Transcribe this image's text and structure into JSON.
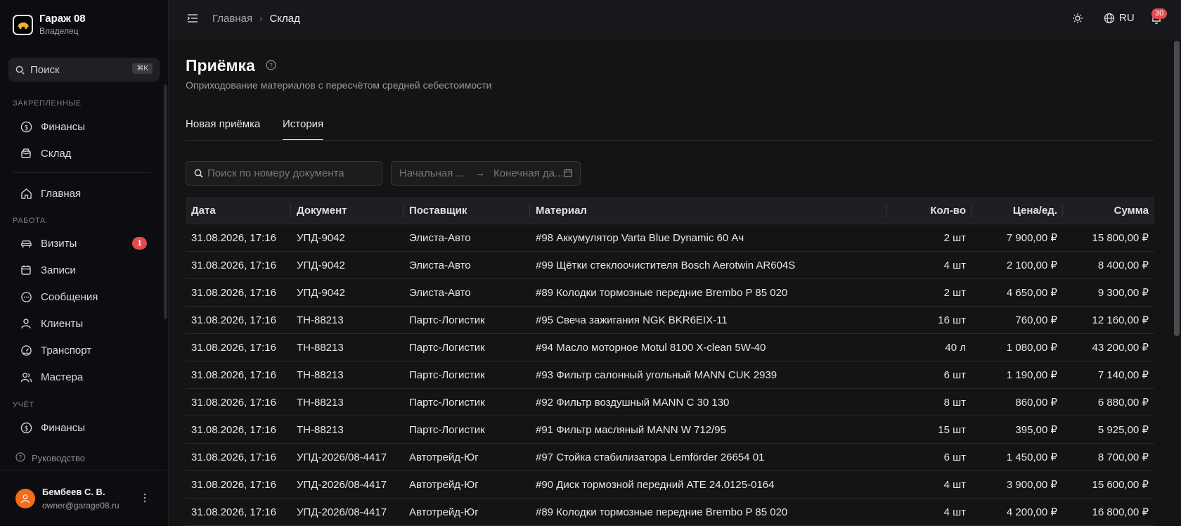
{
  "app": {
    "name": "Гараж 08",
    "role": "Владелец"
  },
  "sidebar": {
    "search_label": "Поиск",
    "search_shortcut": "⌘K",
    "pinned_label": "ЗАКРЕПЛЕННЫЕ",
    "pinned": [
      {
        "label": "Финансы",
        "icon": "dollar-icon"
      },
      {
        "label": "Склад",
        "icon": "box-icon"
      }
    ],
    "home": {
      "label": "Главная",
      "icon": "home-icon"
    },
    "work_label": "РАБОТА",
    "work": [
      {
        "label": "Визиты",
        "icon": "car-icon",
        "badge": "1"
      },
      {
        "label": "Записи",
        "icon": "calendar-icon"
      },
      {
        "label": "Сообщения",
        "icon": "message-icon"
      },
      {
        "label": "Клиенты",
        "icon": "user-icon"
      },
      {
        "label": "Транспорт",
        "icon": "gauge-icon"
      },
      {
        "label": "Мастера",
        "icon": "users-icon"
      }
    ],
    "accounting_label": "УЧЁТ",
    "accounting": [
      {
        "label": "Финансы",
        "icon": "dollar-icon"
      }
    ],
    "guide_label": "Руководство",
    "user": {
      "name": "Бембеев С. В.",
      "email": "owner@garage08.ru"
    }
  },
  "header": {
    "breadcrumb": [
      "Главная",
      "Склад"
    ],
    "lang": "RU",
    "notifications": "30"
  },
  "page": {
    "title": "Приёмка",
    "subtitle": "Оприходование материалов с пересчётом средней себестоимости",
    "tabs": [
      "Новая приёмка",
      "История"
    ],
    "active_tab": "История",
    "doc_search_placeholder": "Поиск по номеру документа",
    "date_start_placeholder": "Начальная ...",
    "date_end_placeholder": "Конечная да..."
  },
  "table": {
    "columns": [
      "Дата",
      "Документ",
      "Поставщик",
      "Материал",
      "Кол-во",
      "Цена/ед.",
      "Сумма"
    ],
    "rows": [
      {
        "date": "31.08.2026, 17:16",
        "doc": "УПД-9042",
        "supplier": "Элиста-Авто",
        "material": "#98 Аккумулятор Varta Blue Dynamic 60 Ач",
        "qty": "2 шт",
        "price": "7 900,00 ₽",
        "sum": "15 800,00 ₽"
      },
      {
        "date": "31.08.2026, 17:16",
        "doc": "УПД-9042",
        "supplier": "Элиста-Авто",
        "material": "#99 Щётки стеклоочистителя Bosch Aerotwin AR604S",
        "qty": "4 шт",
        "price": "2 100,00 ₽",
        "sum": "8 400,00 ₽"
      },
      {
        "date": "31.08.2026, 17:16",
        "doc": "УПД-9042",
        "supplier": "Элиста-Авто",
        "material": "#89 Колодки тормозные передние Brembo P 85 020",
        "qty": "2 шт",
        "price": "4 650,00 ₽",
        "sum": "9 300,00 ₽"
      },
      {
        "date": "31.08.2026, 17:16",
        "doc": "ТН-88213",
        "supplier": "Партс-Логистик",
        "material": "#95 Свеча зажигания NGK BKR6EIX-11",
        "qty": "16 шт",
        "price": "760,00 ₽",
        "sum": "12 160,00 ₽"
      },
      {
        "date": "31.08.2026, 17:16",
        "doc": "ТН-88213",
        "supplier": "Партс-Логистик",
        "material": "#94 Масло моторное Motul 8100 X-clean 5W-40",
        "qty": "40 л",
        "price": "1 080,00 ₽",
        "sum": "43 200,00 ₽"
      },
      {
        "date": "31.08.2026, 17:16",
        "doc": "ТН-88213",
        "supplier": "Партс-Логистик",
        "material": "#93 Фильтр салонный угольный MANN CUK 2939",
        "qty": "6 шт",
        "price": "1 190,00 ₽",
        "sum": "7 140,00 ₽"
      },
      {
        "date": "31.08.2026, 17:16",
        "doc": "ТН-88213",
        "supplier": "Партс-Логистик",
        "material": "#92 Фильтр воздушный MANN C 30 130",
        "qty": "8 шт",
        "price": "860,00 ₽",
        "sum": "6 880,00 ₽"
      },
      {
        "date": "31.08.2026, 17:16",
        "doc": "ТН-88213",
        "supplier": "Партс-Логистик",
        "material": "#91 Фильтр масляный MANN W 712/95",
        "qty": "15 шт",
        "price": "395,00 ₽",
        "sum": "5 925,00 ₽"
      },
      {
        "date": "31.08.2026, 17:16",
        "doc": "УПД-2026/08-4417",
        "supplier": "Автотрейд-Юг",
        "material": "#97 Стойка стабилизатора Lemförder 26654 01",
        "qty": "6 шт",
        "price": "1 450,00 ₽",
        "sum": "8 700,00 ₽"
      },
      {
        "date": "31.08.2026, 17:16",
        "doc": "УПД-2026/08-4417",
        "supplier": "Автотрейд-Юг",
        "material": "#90 Диск тормозной передний ATE 24.0125-0164",
        "qty": "4 шт",
        "price": "3 900,00 ₽",
        "sum": "15 600,00 ₽"
      },
      {
        "date": "31.08.2026, 17:16",
        "doc": "УПД-2026/08-4417",
        "supplier": "Автотрейд-Юг",
        "material": "#89 Колодки тормозные передние Brembo P 85 020",
        "qty": "4 шт",
        "price": "4 200,00 ₽",
        "sum": "16 800,00 ₽"
      }
    ]
  },
  "colors": {
    "accent_badge": "#e5484d",
    "avatar": "#f36c1d"
  }
}
